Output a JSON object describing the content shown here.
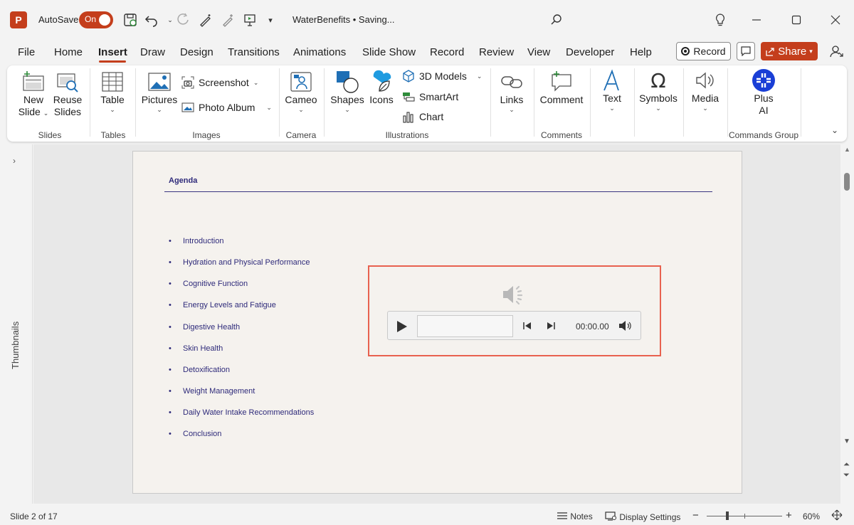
{
  "titlebar": {
    "app_logo": "P",
    "autosave_label": "AutoSave",
    "autosave_state": "On",
    "doc_title": "WaterBenefits • Saving...",
    "accent": "#c43e1c"
  },
  "menu": {
    "tabs": [
      "File",
      "Home",
      "Insert",
      "Draw",
      "Design",
      "Transitions",
      "Animations",
      "Slide Show",
      "Record",
      "Review",
      "View",
      "Developer",
      "Help"
    ],
    "active_tab": "Insert",
    "record_label": "Record",
    "share_label": "Share"
  },
  "ribbon": {
    "new_slide": [
      "New",
      "Slide"
    ],
    "reuse_slides": [
      "Reuse",
      "Slides"
    ],
    "table": "Table",
    "pictures": "Pictures",
    "screenshot": "Screenshot",
    "photo_album": "Photo Album",
    "cameo": "Cameo",
    "shapes": "Shapes",
    "icons": "Icons",
    "models_3d": "3D Models",
    "smartart": "SmartArt",
    "chart": "Chart",
    "links": "Links",
    "comment": "Comment",
    "text": "Text",
    "symbols": "Symbols",
    "media": "Media",
    "plus_ai": [
      "Plus",
      "AI"
    ],
    "groups": {
      "slides": "Slides",
      "tables": "Tables",
      "images": "Images",
      "camera": "Camera",
      "illustrations": "Illustrations",
      "comments": "Comments",
      "commands": "Commands Group"
    }
  },
  "thumbnails_label": "Thumbnails",
  "slide": {
    "title": "Agenda",
    "bullets": [
      "Introduction",
      "Hydration and Physical Performance",
      "Cognitive Function",
      "Energy Levels and Fatigue",
      "Digestive Health",
      "Skin Health",
      "Detoxification",
      "Weight Management",
      "Daily Water Intake Recommendations",
      "Conclusion"
    ],
    "bullet_char": "•",
    "text_color": "#2e2a7a",
    "audio": {
      "time": "00:00.00",
      "progress": 0,
      "highlight_color": "#e8614f"
    }
  },
  "statusbar": {
    "slide_info": "Slide 2 of 17",
    "notes": "Notes",
    "display_settings": "Display Settings",
    "zoom_minus": "−",
    "zoom_plus": "+",
    "zoom_level": "60%"
  }
}
